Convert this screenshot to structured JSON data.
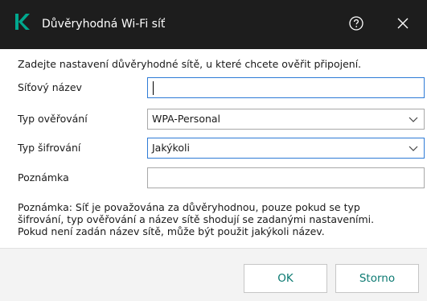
{
  "dialog": {
    "title": "Důvěryhodná Wi-Fi síť",
    "help_icon": "help-circle-icon",
    "close_icon": "close-icon",
    "logo_icon": "kaspersky-k-logo"
  },
  "intro": "Zadejte nastavení důvěryhodné sítě, u které chcete ověřit připojení.",
  "form": {
    "network_name": {
      "label": "Síťový název",
      "value": ""
    },
    "auth_type": {
      "label": "Typ ověřování",
      "value": "WPA-Personal"
    },
    "encryption_type": {
      "label": "Typ šifrování",
      "value": "Jakýkoli"
    },
    "note_field": {
      "label": "Poznámka",
      "value": ""
    }
  },
  "note": {
    "line1": "Poznámka: Síť je považována za důvěryhodnou, pouze pokud se typ",
    "line2": "šifrování, typ ověřování a název sítě shodují se zadanými nastaveními.",
    "line3": "Pokud není zadán název sítě, může být použit jakýkoli název."
  },
  "buttons": {
    "ok": "OK",
    "cancel": "Storno"
  },
  "colors": {
    "titlebar": "#1d1d1d",
    "logo": "#00a88e",
    "focus_border": "#2e7bd6",
    "button_text": "#0c7a72"
  }
}
